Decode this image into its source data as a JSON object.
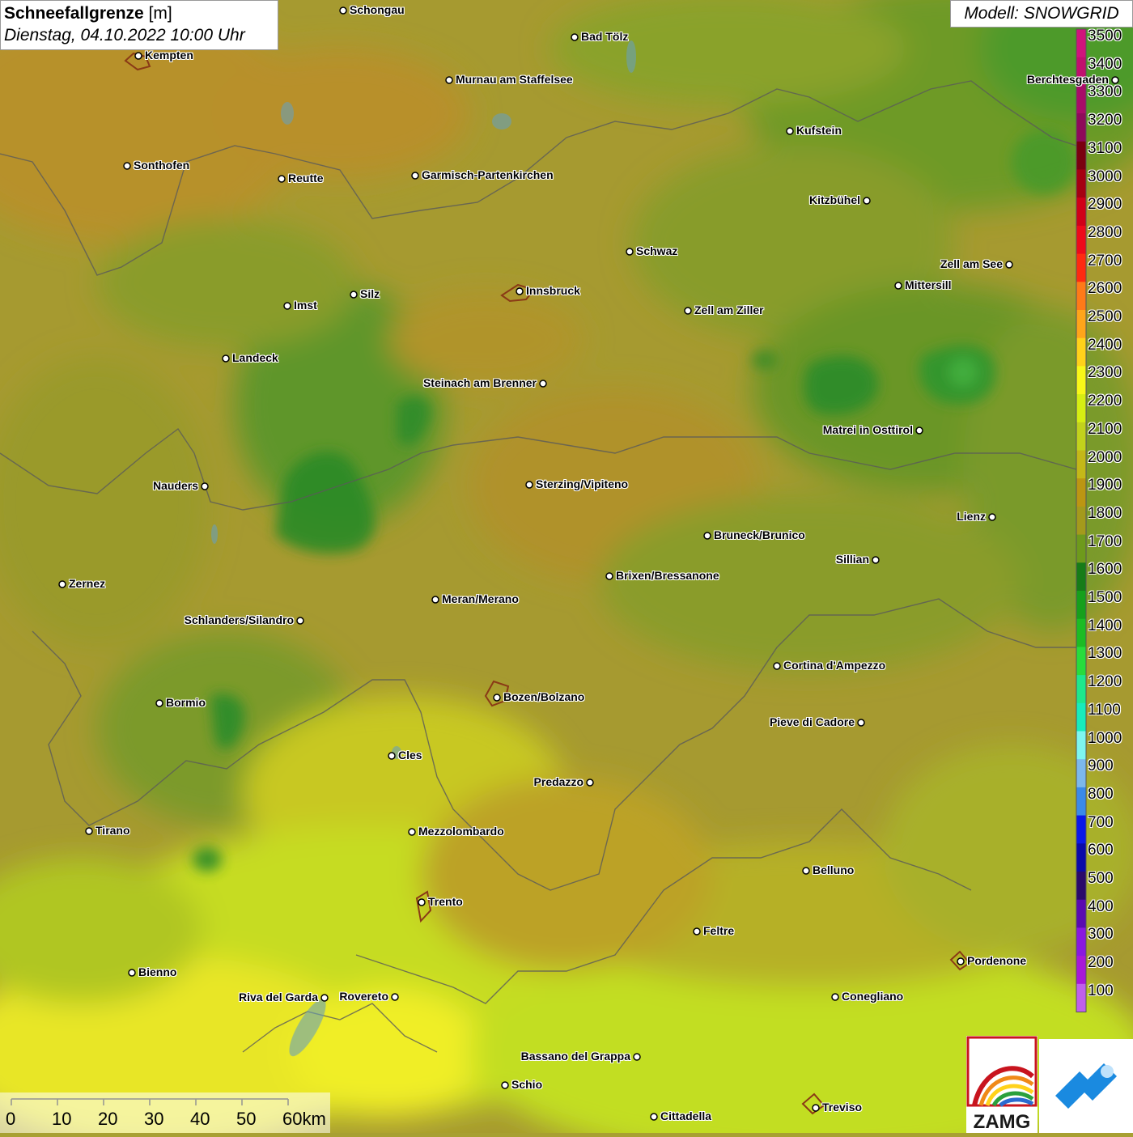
{
  "title": {
    "main": "Schneefallgrenze",
    "unit": "[m]",
    "datetime": "Dienstag, 04.10.2022 10:00 Uhr"
  },
  "model": "Modell: SNOWGRID",
  "legend": {
    "levels": [
      {
        "label": "3500",
        "color": "#d0137c"
      },
      {
        "label": "3400",
        "color": "#c0106e"
      },
      {
        "label": "3300",
        "color": "#a80c68"
      },
      {
        "label": "3200",
        "color": "#8e0a5a"
      },
      {
        "label": "3100",
        "color": "#7a0010"
      },
      {
        "label": "3000",
        "color": "#a50012"
      },
      {
        "label": "2900",
        "color": "#d00018"
      },
      {
        "label": "2800",
        "color": "#ee0a1a"
      },
      {
        "label": "2700",
        "color": "#ff2a10"
      },
      {
        "label": "2600",
        "color": "#ff7a18"
      },
      {
        "label": "2500",
        "color": "#ffa51a"
      },
      {
        "label": "2400",
        "color": "#ffd21a"
      },
      {
        "label": "2300",
        "color": "#f8f818"
      },
      {
        "label": "2200",
        "color": "#d6ee12"
      },
      {
        "label": "2100",
        "color": "#c2d21c"
      },
      {
        "label": "2000",
        "color": "#c4b818"
      },
      {
        "label": "1900",
        "color": "#bc9612"
      },
      {
        "label": "1800",
        "color": "#a49a1c"
      },
      {
        "label": "1700",
        "color": "#6e9a1c"
      },
      {
        "label": "1600",
        "color": "#167c18"
      },
      {
        "label": "1500",
        "color": "#16a01c"
      },
      {
        "label": "1400",
        "color": "#1cbc24"
      },
      {
        "label": "1300",
        "color": "#28dc3c"
      },
      {
        "label": "1200",
        "color": "#1ee88c"
      },
      {
        "label": "1100",
        "color": "#18ecbc"
      },
      {
        "label": "1000",
        "color": "#7ef6f0"
      },
      {
        "label": "900",
        "color": "#7cb8ec"
      },
      {
        "label": "800",
        "color": "#3a8ae8"
      },
      {
        "label": "700",
        "color": "#0a18e8"
      },
      {
        "label": "600",
        "color": "#0a0aa8"
      },
      {
        "label": "500",
        "color": "#2a0a6a"
      },
      {
        "label": "400",
        "color": "#5a0ab0"
      },
      {
        "label": "300",
        "color": "#8a18e0"
      },
      {
        "label": "200",
        "color": "#a818d8"
      },
      {
        "label": "100",
        "color": "#c060ec"
      }
    ]
  },
  "scale": {
    "labels": [
      "0",
      "10",
      "20",
      "30",
      "40",
      "50",
      "60km"
    ]
  },
  "cities": [
    {
      "name": "Schongau"
    },
    {
      "name": "Bad Tölz"
    },
    {
      "name": "Kempten"
    },
    {
      "name": "Murnau am Staffelsee"
    },
    {
      "name": "Berchtesgaden"
    },
    {
      "name": "Kufstein"
    },
    {
      "name": "Sonthofen"
    },
    {
      "name": "Reutte"
    },
    {
      "name": "Garmisch-Partenkirchen"
    },
    {
      "name": "Kitzbühel"
    },
    {
      "name": "Schwaz"
    },
    {
      "name": "Zell am See"
    },
    {
      "name": "Innsbruck"
    },
    {
      "name": "Mittersill"
    },
    {
      "name": "Silz"
    },
    {
      "name": "Imst"
    },
    {
      "name": "Zell am Ziller"
    },
    {
      "name": "Landeck"
    },
    {
      "name": "Steinach am Brenner"
    },
    {
      "name": "Matrei in Osttirol"
    },
    {
      "name": "Nauders"
    },
    {
      "name": "Sterzing/Vipiteno"
    },
    {
      "name": "Lienz"
    },
    {
      "name": "Bruneck/Brunico"
    },
    {
      "name": "Sillian"
    },
    {
      "name": "Brixen/Bressanone"
    },
    {
      "name": "Zernez"
    },
    {
      "name": "Meran/Merano"
    },
    {
      "name": "Schlanders/Silandro"
    },
    {
      "name": "Cortina d'Ampezzo"
    },
    {
      "name": "Bozen/Bolzano"
    },
    {
      "name": "Bormio"
    },
    {
      "name": "Pieve di Cadore"
    },
    {
      "name": "Cles"
    },
    {
      "name": "Predazzo"
    },
    {
      "name": "Tirano"
    },
    {
      "name": "Mezzolombardo"
    },
    {
      "name": "Belluno"
    },
    {
      "name": "Trento"
    },
    {
      "name": "Feltre"
    },
    {
      "name": "Pordenone"
    },
    {
      "name": "Bienno"
    },
    {
      "name": "Riva del Garda"
    },
    {
      "name": "Rovereto"
    },
    {
      "name": "Conegliano"
    },
    {
      "name": "Bassano del Grappa"
    },
    {
      "name": "Schio"
    },
    {
      "name": "Treviso"
    },
    {
      "name": "Cittadella"
    }
  ],
  "logos": {
    "zamg_text": "ZAMG"
  }
}
